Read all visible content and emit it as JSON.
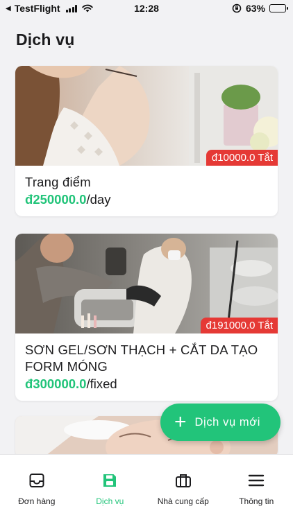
{
  "status_bar": {
    "carrier": "TestFlight",
    "time": "12:28",
    "battery": "63%",
    "battery_level": 0.63
  },
  "header": {
    "title": "Dịch vụ"
  },
  "services": [
    {
      "name": "Trang điểm",
      "currency": "đ",
      "price": "250000.0",
      "unit": "/day",
      "discount": "đ10000.0 Tắt"
    },
    {
      "name": "SƠN GEL/SƠN THẠCH + CẮT DA TẠO FORM MÓNG",
      "currency": "đ",
      "price": "300000.0",
      "unit": "/fixed",
      "discount": "đ191000.0 Tắt"
    }
  ],
  "fab": {
    "plus": "+",
    "label": "Dịch vụ mới"
  },
  "nav": {
    "items": [
      {
        "label": "Đơn hàng",
        "icon": "inbox-icon"
      },
      {
        "label": "Dịch vụ",
        "icon": "save-icon"
      },
      {
        "label": "Nhà cung cấp",
        "icon": "briefcase-icon"
      },
      {
        "label": "Thông tin",
        "icon": "menu-icon"
      }
    ],
    "active_color": "#22c47a"
  },
  "colors": {
    "accent": "#22c47a",
    "discount": "#e53935",
    "background": "#f2f2f4"
  }
}
